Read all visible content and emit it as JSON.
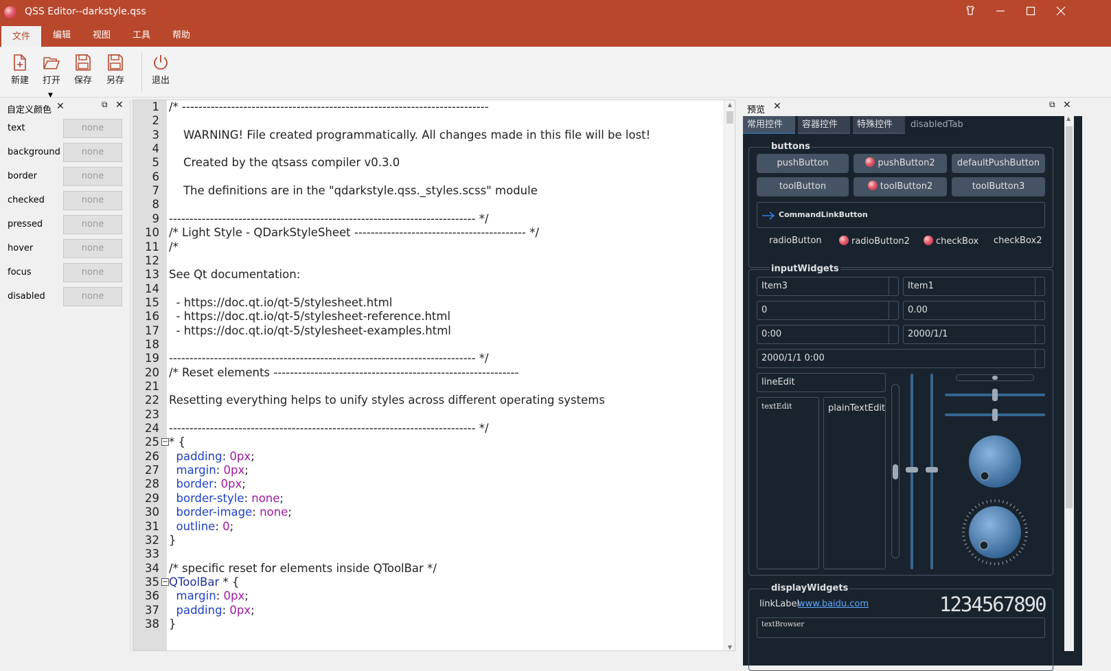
{
  "window": {
    "title": "QSS Editor--darkstyle.qss"
  },
  "menu": [
    "文件",
    "编辑",
    "视图",
    "工具",
    "帮助"
  ],
  "toolbar": {
    "new": "新建",
    "open": "打开",
    "save": "保存",
    "save_as": "另存",
    "exit": "退出"
  },
  "left_dock": {
    "title": "自定义颜色",
    "rows": [
      {
        "name": "text",
        "value": "none"
      },
      {
        "name": "background",
        "value": "none"
      },
      {
        "name": "border",
        "value": "none"
      },
      {
        "name": "checked",
        "value": "none"
      },
      {
        "name": "pressed",
        "value": "none"
      },
      {
        "name": "hover",
        "value": "none"
      },
      {
        "name": "focus",
        "value": "none"
      },
      {
        "name": "disabled",
        "value": "none"
      }
    ]
  },
  "editor": {
    "lines": [
      {
        "n": "1",
        "t": "/* ---------------------------------------------------------------------------"
      },
      {
        "n": "2",
        "t": ""
      },
      {
        "n": "3",
        "t": "    WARNING! File created programmatically. All changes made in this file will be lost!"
      },
      {
        "n": "4",
        "t": ""
      },
      {
        "n": "5",
        "t": "    Created by the qtsass compiler v0.3.0"
      },
      {
        "n": "6",
        "t": ""
      },
      {
        "n": "7",
        "t": "    The definitions are in the \"qdarkstyle.qss._styles.scss\" module"
      },
      {
        "n": "8",
        "t": ""
      },
      {
        "n": "9",
        "t": "--------------------------------------------------------------------------- */"
      },
      {
        "n": "10",
        "t": "/* Light Style - QDarkStyleSheet ------------------------------------------ */"
      },
      {
        "n": "11",
        "t": "/*"
      },
      {
        "n": "12",
        "t": ""
      },
      {
        "n": "13",
        "t": "See Qt documentation:"
      },
      {
        "n": "14",
        "t": ""
      },
      {
        "n": "15",
        "t": "  - https://doc.qt.io/qt-5/stylesheet.html"
      },
      {
        "n": "16",
        "t": "  - https://doc.qt.io/qt-5/stylesheet-reference.html"
      },
      {
        "n": "17",
        "t": "  - https://doc.qt.io/qt-5/stylesheet-examples.html"
      },
      {
        "n": "18",
        "t": ""
      },
      {
        "n": "19",
        "t": "--------------------------------------------------------------------------- */"
      },
      {
        "n": "20",
        "t": "/* Reset elements ------------------------------------------------------------"
      },
      {
        "n": "21",
        "t": ""
      },
      {
        "n": "22",
        "t": "Resetting everything helps to unify styles across different operating systems"
      },
      {
        "n": "23",
        "t": ""
      },
      {
        "n": "24",
        "t": "--------------------------------------------------------------------------- */"
      },
      {
        "n": "25",
        "t": "* {",
        "fold": true
      },
      {
        "n": "26",
        "t": "  ",
        "p": "padding",
        "v": "0px"
      },
      {
        "n": "27",
        "t": "  ",
        "p": "margin",
        "v": "0px"
      },
      {
        "n": "28",
        "t": "  ",
        "p": "border",
        "v": "0px"
      },
      {
        "n": "29",
        "t": "  ",
        "p": "border-style",
        "v": "none"
      },
      {
        "n": "30",
        "t": "  ",
        "p": "border-image",
        "v": "none"
      },
      {
        "n": "31",
        "t": "  ",
        "p": "outline",
        "v": "0"
      },
      {
        "n": "32",
        "t": "}"
      },
      {
        "n": "33",
        "t": ""
      },
      {
        "n": "34",
        "t": "/* specific reset for elements inside QToolBar */"
      },
      {
        "n": "35",
        "t": " * {",
        "sel": "QToolBar",
        "fold": true
      },
      {
        "n": "36",
        "t": "  ",
        "p": "margin",
        "v": "0px"
      },
      {
        "n": "37",
        "t": "  ",
        "p": "padding",
        "v": "0px"
      },
      {
        "n": "38",
        "t": "}"
      }
    ]
  },
  "right_dock": {
    "title": "预览",
    "tabs": [
      "常用控件",
      "容器控件",
      "特殊控件",
      "disabledTab"
    ],
    "buttons_group": "buttons",
    "push_buttons": [
      "pushButton",
      "pushButton2",
      "defaultPushButton"
    ],
    "tool_buttons": [
      "toolButton",
      "toolButton2",
      "toolButton3"
    ],
    "command_link": "CommandLinkButton",
    "radios": [
      "radioButton",
      "radioButton2",
      "checkBox",
      "checkBox2"
    ],
    "input_group": "inputWidgets",
    "combo1": "Item3",
    "combo2": "Item1",
    "spin1": "0",
    "spin2": "0.00",
    "time": "0:00",
    "date": "2000/1/1",
    "datetime": "2000/1/1 0:00",
    "line_edit": "lineEdit",
    "text_edit": "textEdit",
    "plain_text_edit": "plainTextEdit",
    "display_group": "displayWidgets",
    "link_label": "linkLabel",
    "link": "baidu.com",
    "link_full": "www.baidu.com",
    "lcd": "1234567890",
    "text_browser": "textBrowser"
  },
  "colors": {
    "title_bar": "#b8472c",
    "preview_bg": "#19232d",
    "accent": "#346792",
    "widget": "#455364"
  }
}
